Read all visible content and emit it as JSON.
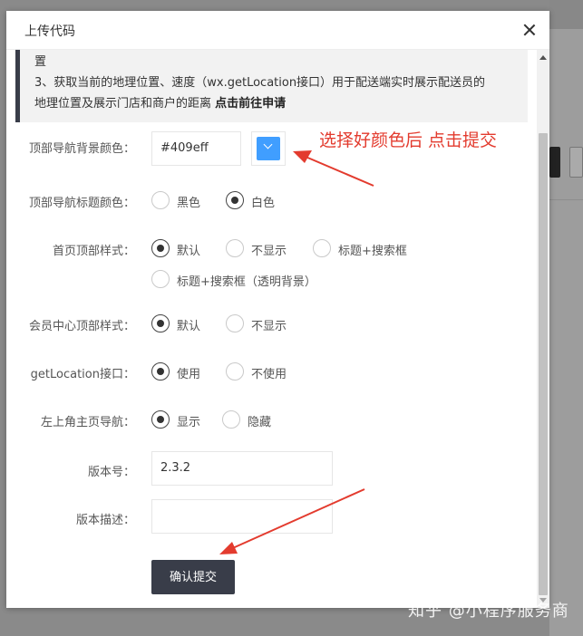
{
  "dialog": {
    "title": "上传代码"
  },
  "notice": {
    "line1": "置",
    "line2": "3、获取当前的地理位置、速度（wx.getLocation接口）用于配送端实时展示配送员的",
    "line3_prefix": "地理位置及展示门店和商户的距离 ",
    "line3_link": "点击前往申请"
  },
  "form": {
    "nav_bg": {
      "label": "顶部导航背景颜色：",
      "value": "#409eff"
    },
    "nav_title_color": {
      "label": "顶部导航标题颜色：",
      "options": [
        "黑色",
        "白色"
      ],
      "selected": "白色"
    },
    "home_header": {
      "label": "首页顶部样式：",
      "options": [
        "默认",
        "不显示",
        "标题+搜索框",
        "标题+搜索框（透明背景）"
      ],
      "selected": "默认"
    },
    "member_header": {
      "label": "会员中心顶部样式：",
      "options": [
        "默认",
        "不显示"
      ],
      "selected": "默认"
    },
    "get_location": {
      "label": "getLocation接口：",
      "options": [
        "使用",
        "不使用"
      ],
      "selected": "使用"
    },
    "home_nav": {
      "label": "左上角主页导航：",
      "options": [
        "显示",
        "隐藏"
      ],
      "selected": "显示"
    },
    "version": {
      "label": "版本号：",
      "value": "2.3.2"
    },
    "version_desc": {
      "label": "版本描述：",
      "value": ""
    },
    "submit_label": "确认提交"
  },
  "annotation": "选择好颜色后 点击提交",
  "watermark": "知乎 @小程序服务商",
  "colors": {
    "accent": "#409eff",
    "annotation": "#e33b2e",
    "submit_bg": "#393d49"
  }
}
